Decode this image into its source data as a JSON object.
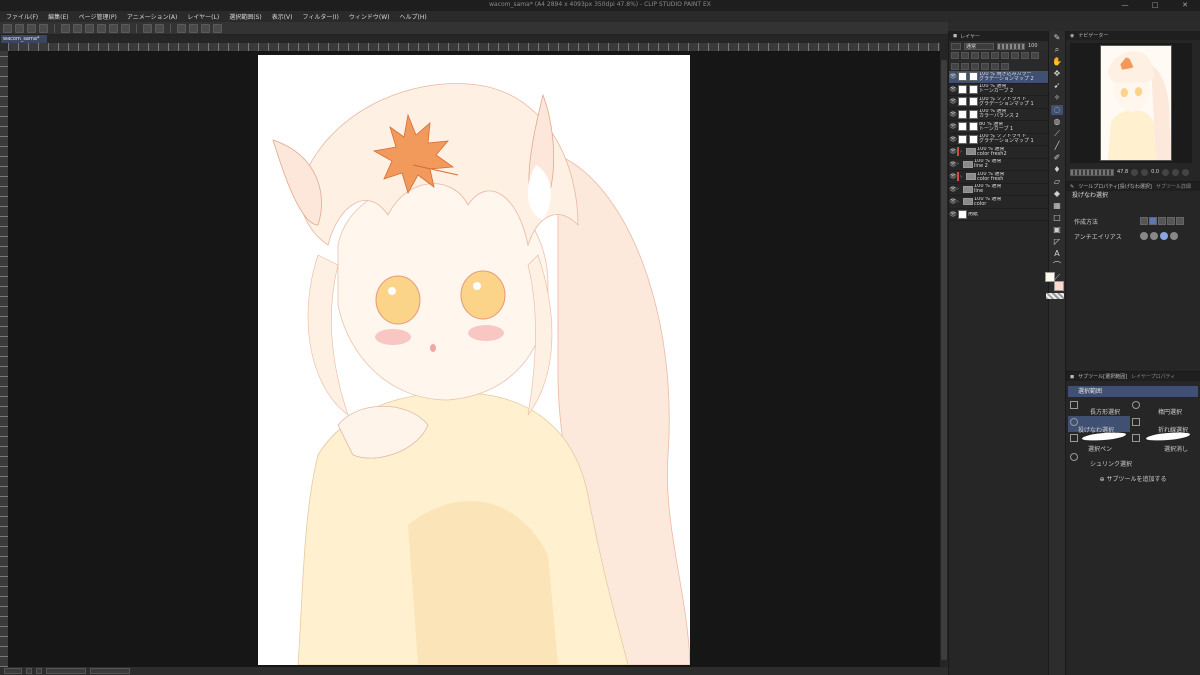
{
  "window": {
    "title": "wacom_sama* (A4 2894 x 4093px 350dpi 47.8%) - CLIP STUDIO PAINT EX",
    "controls": [
      "—",
      "□",
      "✕"
    ]
  },
  "menu": [
    "ファイル(F)",
    "編集(E)",
    "ページ管理(P)",
    "アニメーション(A)",
    "レイヤー(L)",
    "選択範囲(S)",
    "表示(V)",
    "フィルター(I)",
    "ウィンドウ(W)",
    "ヘルプ(H)"
  ],
  "document_tab": "wacom_sama*",
  "layers": {
    "panel_title": "レイヤー",
    "blend_mode": "通常",
    "opacity": "100",
    "items": [
      {
        "percent_mode": "100 % 焼き込みカラー",
        "name": "グラデーションマップ 2",
        "thumb": "white",
        "kind": "layer",
        "selected": true
      },
      {
        "percent_mode": "100 % 通常",
        "name": "トーンカーブ 2",
        "thumb": "white",
        "kind": "layer"
      },
      {
        "percent_mode": "100 % ソフトライト",
        "name": "グラデーションマップ 1",
        "thumb": "white",
        "kind": "layer"
      },
      {
        "percent_mode": "100 % 通常",
        "name": "カラーバランス 2",
        "thumb": "white",
        "kind": "layer"
      },
      {
        "percent_mode": "80 % 通常",
        "name": "トーンカーブ 1",
        "thumb": "white",
        "kind": "layer"
      },
      {
        "percent_mode": "100 % ソフトライト",
        "name": "グラデーションマップ 1",
        "thumb": "white",
        "kind": "layer"
      },
      {
        "percent_mode": "100 % 通常",
        "name": "color fresh2",
        "thumb": "folder",
        "kind": "folder",
        "red": true
      },
      {
        "percent_mode": "100 % 通常",
        "name": "line 2",
        "thumb": "folder",
        "kind": "folder"
      },
      {
        "percent_mode": "100 % 通常",
        "name": "color fresh",
        "thumb": "folder",
        "kind": "folder",
        "red": true
      },
      {
        "percent_mode": "100 % 通常",
        "name": "line",
        "thumb": "folder",
        "kind": "folder"
      },
      {
        "percent_mode": "100 % 通常",
        "name": "color",
        "thumb": "folder",
        "kind": "folder"
      },
      {
        "percent_mode": "",
        "name": "用紙",
        "thumb": "white",
        "kind": "paper"
      }
    ]
  },
  "navigator": {
    "title": "ナビゲーター",
    "zoom": "47.8",
    "rotation": "0.0"
  },
  "tool_property": {
    "header": "ツールプロパティ[投げなわ選択]",
    "tab2": "サブツール詳細",
    "title": "投げなわ選択",
    "rows": [
      {
        "label": "作成方法"
      },
      {
        "label": "アンチエイリアス"
      }
    ]
  },
  "subtool": {
    "header": "サブツール[選択範囲]",
    "tab2": "レイヤープロパティ",
    "group": "選択範囲",
    "items": {
      "rect": "長方形選択",
      "ellipse": "楕円選択",
      "lasso": "投げなわ選択",
      "polyline": "折れ線選択",
      "selection_pen": "選択ペン",
      "selection_eraser": "選択消し",
      "shrink": "シュリンク選択"
    },
    "add_label": "サブツールを追加する"
  },
  "colors": {
    "main": "#fff8ef",
    "sub": "#ffd9d1",
    "accent": "#3f5073"
  }
}
